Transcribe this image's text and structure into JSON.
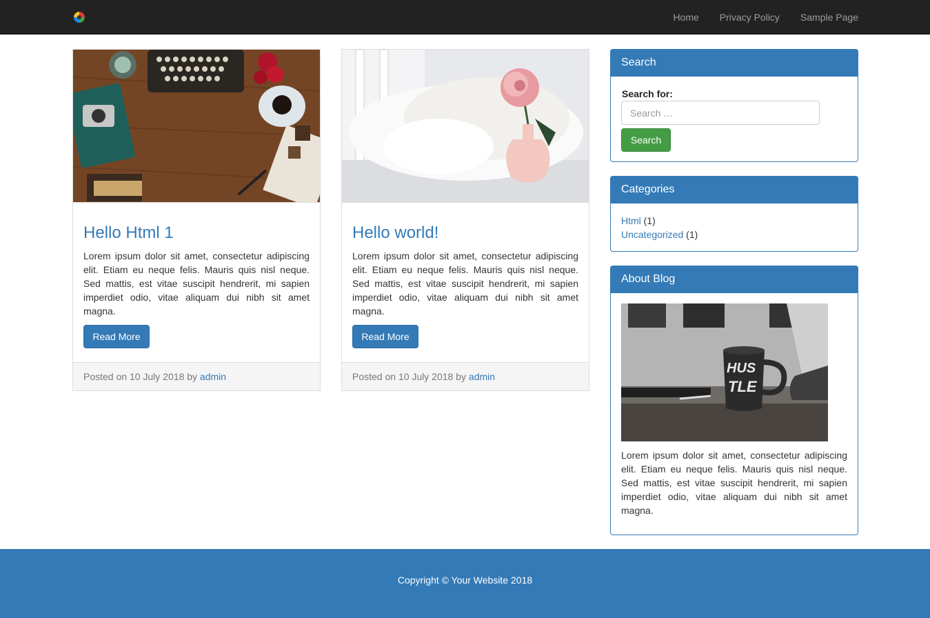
{
  "nav": {
    "logo_icon": "colorful-pinwheel-logo",
    "links": [
      "Home",
      "Privacy Policy",
      "Sample Page"
    ]
  },
  "posts": [
    {
      "title": "Hello Html 1",
      "excerpt": "Lorem ipsum dolor sit amet, consectetur adipiscing elit. Etiam eu neque felis. Mauris quis nisl neque. Sed mattis, est vitae suscipit hendrerit, mi sapien imperdiet odio, vitae aliquam dui nibh sit amet magna.",
      "button": "Read More",
      "posted_prefix": "Posted on 10 July 2018 by",
      "author": "admin",
      "image": "typewriter-desk-flatlay"
    },
    {
      "title": "Hello world!",
      "excerpt": "Lorem ipsum dolor sit amet, consectetur adipiscing elit. Etiam eu neque felis. Mauris quis nisl neque. Sed mattis, est vitae suscipit hendrerit, mi sapien imperdiet odio, vitae aliquam dui nibh sit amet magna.",
      "button": "Read More",
      "posted_prefix": "Posted on 10 July 2018 by",
      "author": "admin",
      "image": "pink-rose-in-vase"
    }
  ],
  "sidebar": {
    "search": {
      "heading": "Search",
      "label": "Search for:",
      "placeholder": "Search …",
      "button": "Search"
    },
    "categories": {
      "heading": "Categories",
      "items": [
        {
          "name": "Html",
          "count": "(1)"
        },
        {
          "name": "Uncategorized",
          "count": "(1)"
        }
      ]
    },
    "about": {
      "heading": "About Blog",
      "image": "hustle-mug-on-desk",
      "text": "Lorem ipsum dolor sit amet, consectetur adipiscing elit. Etiam eu neque felis. Mauris quis nisl neque. Sed mattis, est vitae suscipit hendrerit, mi sapien imperdiet odio, vitae aliquam dui nibh sit amet magna.",
      "mug_text_1": "HUS",
      "mug_text_2": "TLE"
    }
  },
  "footer": {
    "copyright": "Copyright © Your Website 2018"
  },
  "colors": {
    "navbar": "#222222",
    "primary": "#337ab7",
    "success": "#449d44",
    "footer": "#337ab7"
  }
}
